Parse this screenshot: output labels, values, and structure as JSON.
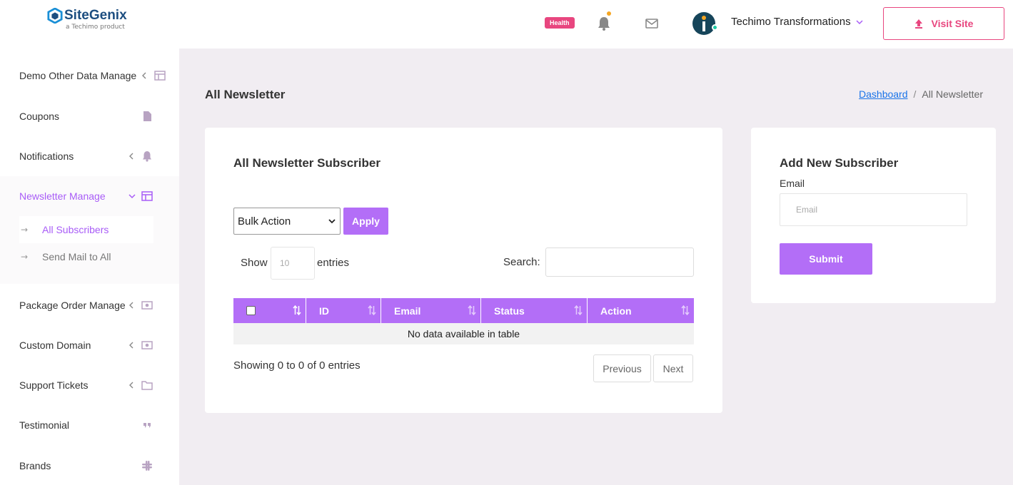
{
  "brand": {
    "name": "SiteGenix",
    "tagline": "a Techimo product",
    "color": "#1d4e80"
  },
  "header": {
    "health_badge": "Health",
    "user_name": "Techimo Transformations",
    "visit_site_label": "Visit Site",
    "notification_icon": "bell-icon",
    "mail_icon": "mail-icon"
  },
  "sidebar": {
    "items": [
      {
        "label": "Demo Other Data Manage",
        "icon": "table-icon",
        "has_chevron": true
      },
      {
        "label": "Coupons",
        "icon": "file-icon",
        "has_chevron": false
      },
      {
        "label": "Notifications",
        "icon": "bell-icon",
        "has_chevron": true
      },
      {
        "label": "Newsletter Manage",
        "icon": "table-icon",
        "has_chevron": true,
        "expanded": true
      },
      {
        "label": "Package Order Manage",
        "icon": "money-icon",
        "has_chevron": true
      },
      {
        "label": "Custom Domain",
        "icon": "money-icon",
        "has_chevron": true
      },
      {
        "label": "Support Tickets",
        "icon": "folder-icon",
        "has_chevron": true
      },
      {
        "label": "Testimonial",
        "icon": "quote-icon",
        "has_chevron": false
      },
      {
        "label": "Brands",
        "icon": "slack-icon",
        "has_chevron": false
      }
    ],
    "subitems": [
      {
        "label": "All Subscribers",
        "active": true
      },
      {
        "label": "Send Mail to All",
        "active": false
      }
    ]
  },
  "page": {
    "title": "All Newsletter",
    "breadcrumb": {
      "home": "Dashboard",
      "separator": "/",
      "current": "All Newsletter"
    }
  },
  "subscriber_list": {
    "title": "All Newsletter Subscriber",
    "bulk_action": "Bulk Action",
    "apply_label": "Apply",
    "show_label": "Show",
    "entries_value": "10",
    "entries_label": "entries",
    "search_label": "Search:",
    "columns": [
      "ID",
      "Email",
      "Status",
      "Action"
    ],
    "empty_message": "No data available in table",
    "showing_text": "Showing 0 to 0 of 0 entries",
    "prev_label": "Previous",
    "next_label": "Next"
  },
  "add_subscriber": {
    "title": "Add New Subscriber",
    "email_label": "Email",
    "email_placeholder": "Email",
    "submit_label": "Submit"
  },
  "colors": {
    "accent": "#b36ef7",
    "active_text": "#a85cf7",
    "pink": "#e8467f",
    "background": "#f1edf2"
  }
}
